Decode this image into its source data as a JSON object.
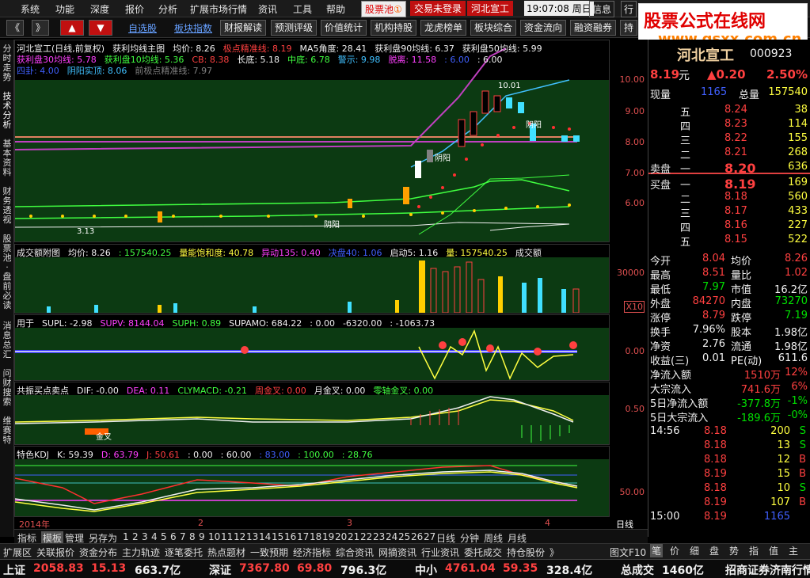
{
  "menubar": {
    "items": [
      "系统",
      "功能",
      "深度",
      "报价",
      "分析",
      "扩展市场行情",
      "资讯",
      "工具",
      "帮助"
    ],
    "pool": "股票池",
    "pool_badge": "①",
    "login": "交易未登录",
    "stock": "河北宣工",
    "time": "19:07:08",
    "weekday": "周日",
    "right": [
      "信息",
      "行"
    ]
  },
  "toolbar": {
    "nav": [
      "《",
      "》",
      "▲",
      "▼"
    ],
    "links": [
      "自选股",
      "板块指数"
    ],
    "buttons": [
      "财报解读",
      "预测评级",
      "价值统计",
      "机构持股",
      "龙虎榜单",
      "板块综合",
      "资金流向",
      "融资融券",
      "持"
    ]
  },
  "watermark": {
    "title": "股票公式在线网",
    "url": "www.gsxx.com.cn"
  },
  "lefttabs": [
    "分时走势",
    "技术分析",
    "基本资料",
    "财务透视",
    "股票池·盘前必读",
    "消息总汇",
    "问财搜索",
    "维赛特"
  ],
  "main": {
    "header1": [
      {
        "t": "河北宣工(日线,前复权)",
        "c": "#f0f0f0"
      },
      {
        "t": "获利均线主图",
        "c": "#f0f0f0"
      },
      {
        "t": "均价: 8.26",
        "c": "#f0f0f0"
      },
      {
        "t": "极点精准线: 8.19",
        "c": "#ff4040"
      },
      {
        "t": "MA5角度: 28.41",
        "c": "#f0f0f0"
      },
      {
        "t": "获利盘90均线: 6.37",
        "c": "#f0f0f0"
      },
      {
        "t": "获利盘50均线: 5.99",
        "c": "#f0f0f0"
      }
    ],
    "header2": [
      {
        "t": "获利盘30均线: 5.78",
        "c": "#ff40ff"
      },
      {
        "t": "获利盘10均线: 5.36",
        "c": "#40ff40"
      },
      {
        "t": "CB: 8.38",
        "c": "#ff4040"
      },
      {
        "t": "长底: 5.18",
        "c": "#f0f0f0"
      },
      {
        "t": "中底: 6.78",
        "c": "#40ff40"
      },
      {
        "t": "警示: 9.98",
        "c": "#40c0ff"
      },
      {
        "t": "脱离: 11.58",
        "c": "#ff40ff"
      },
      {
        "t": ": 6.00",
        "c": "#4060ff"
      },
      {
        "t": ": 6.00",
        "c": "#f0f0f0"
      }
    ],
    "header3": [
      {
        "t": "四卦: 4.00",
        "c": "#4060ff"
      },
      {
        "t": "阴阳实顶: 8.06",
        "c": "#40c0ff"
      },
      {
        "t": "前极点精准线: 7.97",
        "c": "#808080"
      }
    ],
    "labels": [
      "10.01",
      "阴阳",
      "阴阳",
      "阴阳",
      "3.13"
    ],
    "yticks": [
      "10.00",
      "9.00",
      "8.00",
      "7.00",
      "6.00"
    ]
  },
  "volume": {
    "header": [
      {
        "t": "成交额附图",
        "c": "#f0f0f0"
      },
      {
        "t": "均价: 8.26",
        "c": "#f0f0f0"
      },
      {
        "t": ": 157540.25",
        "c": "#40ff40"
      },
      {
        "t": "量能饱和度: 40.78",
        "c": "#ffff40"
      },
      {
        "t": "异动135: 0.40",
        "c": "#ff40ff"
      },
      {
        "t": "决盘40: 1.06",
        "c": "#4060ff"
      },
      {
        "t": "启动5: 1.16",
        "c": "#f0f0f0"
      },
      {
        "t": "量: 157540.25",
        "c": "#ffff40"
      },
      {
        "t": "成交额",
        "c": "#f0f0f0"
      }
    ],
    "yticks": [
      "30000",
      "X10"
    ]
  },
  "supl": {
    "header": [
      {
        "t": "用于",
        "c": "#f0f0f0"
      },
      {
        "t": "SUPL: -2.98",
        "c": "#f0f0f0"
      },
      {
        "t": "SUPV: 8144.04",
        "c": "#ff40ff"
      },
      {
        "t": "SUPH: 0.89",
        "c": "#40ff40"
      },
      {
        "t": "SUPAMO: 684.22",
        "c": "#f0f0f0"
      },
      {
        "t": ": 0.00",
        "c": "#f0f0f0"
      },
      {
        "t": "-6320.00",
        "c": "#f0f0f0"
      },
      {
        "t": ": -1063.73",
        "c": "#f0f0f0"
      }
    ],
    "yticks": [
      "0.00"
    ]
  },
  "macd": {
    "header": [
      {
        "t": "共振买点卖点",
        "c": "#f0f0f0"
      },
      {
        "t": "DIF: -0.00",
        "c": "#f0f0f0"
      },
      {
        "t": "DEA: 0.11",
        "c": "#ff40ff"
      },
      {
        "t": "CLYMACD: -0.21",
        "c": "#40ff40"
      },
      {
        "t": "周金叉: 0.00",
        "c": "#ff4040"
      },
      {
        "t": "月金叉: 0.00",
        "c": "#f0f0f0"
      },
      {
        "t": "零轴金叉: 0.00",
        "c": "#40ff40"
      }
    ],
    "label": "金叉",
    "yticks": [
      "0.50"
    ]
  },
  "kdj": {
    "header": [
      {
        "t": "特色KDJ",
        "c": "#f0f0f0"
      },
      {
        "t": "K: 59.39",
        "c": "#f0f0f0"
      },
      {
        "t": "D: 63.79",
        "c": "#ff40ff"
      },
      {
        "t": "J: 50.61",
        "c": "#ff4040"
      },
      {
        "t": ": 0.00",
        "c": "#f0f0f0"
      },
      {
        "t": ": 60.00",
        "c": "#f0f0f0"
      },
      {
        "t": ": 83.00",
        "c": "#4060ff"
      },
      {
        "t": ": 100.00",
        "c": "#40ff40"
      },
      {
        "t": ": 28.76",
        "c": "#40ff40"
      }
    ],
    "yticks": [
      "50.00"
    ]
  },
  "timeaxis": {
    "labels": [
      "2014年",
      "2",
      "3",
      "4"
    ],
    "period": "日线"
  },
  "bottomtabs": [
    "指标",
    "模板",
    "管理",
    "另存为",
    "1",
    "2",
    "3",
    "4",
    "5",
    "6",
    "7",
    "8",
    "9",
    "10",
    "11",
    "12",
    "13",
    "14",
    "15",
    "16",
    "17",
    "18",
    "19",
    "20",
    "21",
    "22",
    "23",
    "24",
    "25",
    "26",
    "27",
    "日线",
    "分钟",
    "周线",
    "月线"
  ],
  "taskbar": [
    "扩展区",
    "关联报价",
    "资金分布",
    "主力轨迹",
    "逐笔委托",
    "热点题材",
    "一致预期",
    "经济指标",
    "综合资讯",
    "网摘资讯",
    "行业资讯",
    "委托成交",
    "持仓股份",
    "》"
  ],
  "taskbar_right": "图文F10",
  "rightpanel": {
    "name": "河北宣工",
    "code": "000923",
    "price": "8.19",
    "price_unit": "元",
    "change": "▲0.20",
    "pct": "2.50%",
    "now_label": "现量",
    "now": "1165",
    "total_label": "总量",
    "total": "157540",
    "asks": [
      [
        "五",
        "8.24",
        "38"
      ],
      [
        "四",
        "8.23",
        "114"
      ],
      [
        "三",
        "8.22",
        "155"
      ],
      [
        "二",
        "8.21",
        "268"
      ],
      [
        "一",
        "8.20",
        "636"
      ]
    ],
    "ask_label": "卖盘",
    "bids": [
      [
        "一",
        "8.19",
        "169"
      ],
      [
        "二",
        "8.18",
        "560"
      ],
      [
        "三",
        "8.17",
        "433"
      ],
      [
        "四",
        "8.16",
        "227"
      ],
      [
        "五",
        "8.15",
        "522"
      ]
    ],
    "bid_label": "买盘",
    "stats": [
      [
        [
          "今开",
          "8.04",
          "red"
        ],
        [
          "均价",
          "8.26",
          "red"
        ]
      ],
      [
        [
          "最高",
          "8.51",
          "red"
        ],
        [
          "量比",
          "1.02",
          "red"
        ]
      ],
      [
        [
          "最低",
          "7.97",
          "grn"
        ],
        [
          "市值",
          "16.2亿",
          "wht"
        ]
      ],
      [
        [
          "外盘",
          "84270",
          "red"
        ],
        [
          "内盘",
          "73270",
          "grn"
        ]
      ],
      [
        [
          "涨停",
          "8.79",
          "red"
        ],
        [
          "跌停",
          "7.19",
          "grn"
        ]
      ],
      [
        [
          "换手",
          "7.96%",
          "wht"
        ],
        [
          "股本",
          "1.98亿",
          "wht"
        ]
      ],
      [
        [
          "净资",
          "2.76",
          "wht"
        ],
        [
          "流通",
          "1.98亿",
          "wht"
        ]
      ],
      [
        [
          "收益(三)",
          "0.01",
          "wht"
        ],
        [
          "PE(动)",
          "611.6",
          "wht"
        ]
      ]
    ],
    "flows": [
      [
        "净流入额",
        "1510万",
        "12%",
        "red"
      ],
      [
        "大宗流入",
        "741.6万",
        "6%",
        "red"
      ],
      [
        "5日净流入额",
        "-377.8万",
        "-1%",
        "grn"
      ],
      [
        "5日大宗流入",
        "-189.6万",
        "-0%",
        "grn"
      ]
    ],
    "ticks": [
      [
        "14:56",
        "8.18",
        "200",
        "S"
      ],
      [
        "",
        "8.18",
        "13",
        "S"
      ],
      [
        "",
        "8.18",
        "12",
        "B"
      ],
      [
        "",
        "8.19",
        "15",
        "B"
      ],
      [
        "",
        "8.18",
        "10",
        "S"
      ],
      [
        "",
        "8.19",
        "107",
        "B"
      ],
      [
        "15:00",
        "8.19",
        "1165",
        ""
      ]
    ],
    "tabs": [
      "笔",
      "价",
      "细",
      "盘",
      "势",
      "指",
      "值",
      "主"
    ]
  },
  "statusbar": [
    {
      "t": "上证",
      "c": "#f0f0f0"
    },
    {
      "t": "2058.83",
      "c": "#ff4040"
    },
    {
      "t": "15.13",
      "c": "#ff4040"
    },
    {
      "t": "663.7亿",
      "c": "#f0f0f0"
    },
    {
      "t": "深证",
      "c": "#f0f0f0"
    },
    {
      "t": "7367.80",
      "c": "#ff4040"
    },
    {
      "t": "69.80",
      "c": "#ff4040"
    },
    {
      "t": "796.3亿",
      "c": "#f0f0f0"
    },
    {
      "t": "中小",
      "c": "#f0f0f0"
    },
    {
      "t": "4761.04",
      "c": "#ff4040"
    },
    {
      "t": "59.35",
      "c": "#ff4040"
    },
    {
      "t": "328.4亿",
      "c": "#f0f0f0"
    },
    {
      "t": "总成交",
      "c": "#f0f0f0"
    },
    {
      "t": "1460亿",
      "c": "#f0f0f0"
    },
    {
      "t": "招商证券济南行情 V...",
      "c": "#f0f0f0"
    }
  ]
}
